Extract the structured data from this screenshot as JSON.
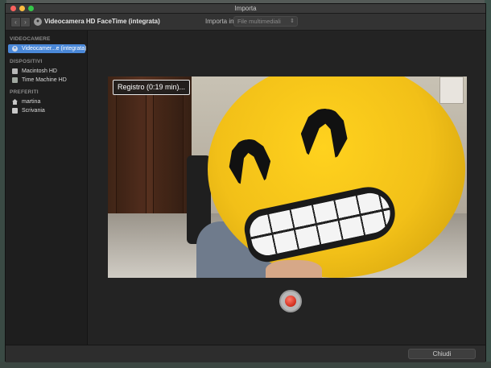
{
  "window": {
    "title": "Importa"
  },
  "toolbar": {
    "device_title": "Videocamera HD FaceTime (integrata)",
    "import_label": "Importa in:",
    "import_value": "File multimediali",
    "back_glyph": "‹",
    "forward_glyph": "›"
  },
  "sidebar": {
    "sections": [
      {
        "title": "VIDEOCAMERE",
        "items": [
          {
            "label": "Videocamer...e (integrata)",
            "icon": "camera-icon",
            "selected": true
          }
        ]
      },
      {
        "title": "DISPOSITIVI",
        "items": [
          {
            "label": "Macintosh HD",
            "icon": "disk-icon",
            "selected": false
          },
          {
            "label": "Time Machine HD",
            "icon": "time-machine-icon",
            "selected": false
          }
        ]
      },
      {
        "title": "PREFERITI",
        "items": [
          {
            "label": "martina",
            "icon": "home-icon",
            "selected": false
          },
          {
            "label": "Scrivania",
            "icon": "desktop-icon",
            "selected": false
          }
        ]
      }
    ]
  },
  "preview": {
    "status": "Registro (0:19 min)..."
  },
  "footer": {
    "close_label": "Chiudi"
  },
  "colors": {
    "accent": "#4a88d8",
    "record": "#d12d1c"
  }
}
